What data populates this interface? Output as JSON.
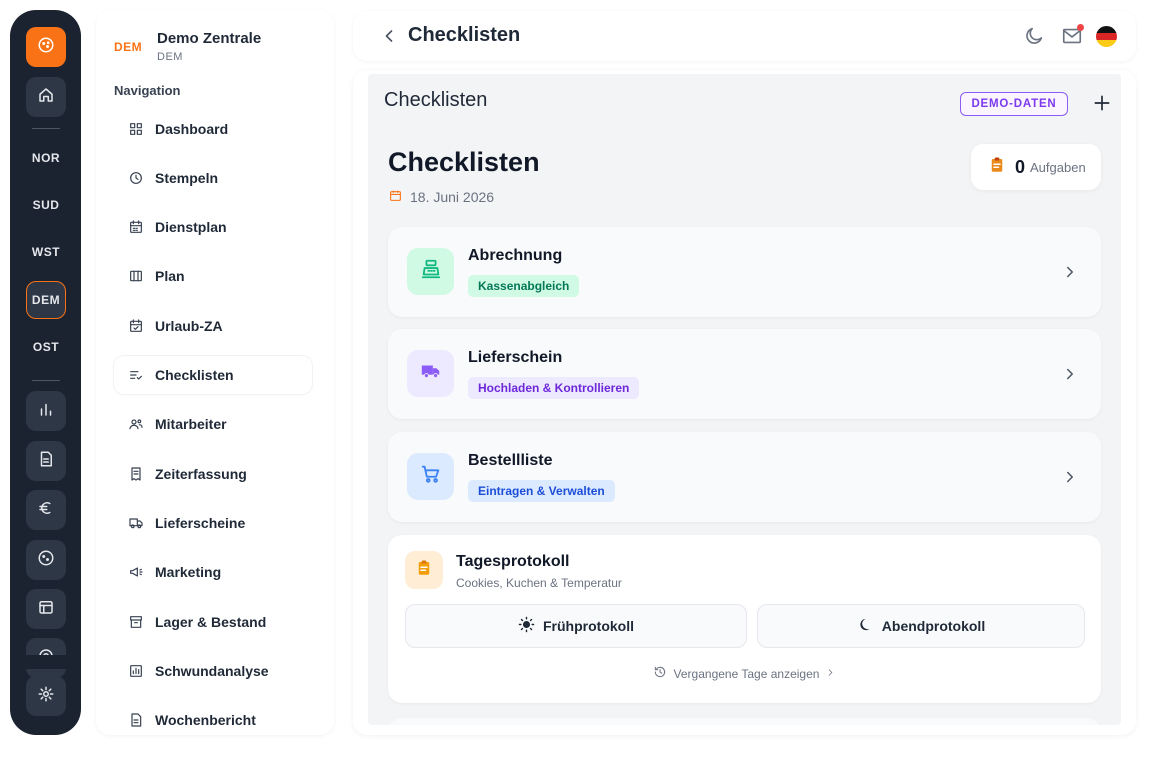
{
  "rail": {
    "codes": [
      "NOR",
      "SUD",
      "WST",
      "DEM",
      "OST"
    ],
    "active_code": "DEM"
  },
  "sidebar": {
    "org_code": "DEM",
    "org_name": "Demo Zentrale",
    "org_sub": "DEM",
    "nav_title": "Navigation",
    "items": [
      {
        "label": "Dashboard",
        "icon": "grid-icon"
      },
      {
        "label": "Stempeln",
        "icon": "clock-icon"
      },
      {
        "label": "Dienstplan",
        "icon": "calendar-grid-icon"
      },
      {
        "label": "Plan",
        "icon": "columns-icon"
      },
      {
        "label": "Urlaub-ZA",
        "icon": "calendar-check-icon"
      },
      {
        "label": "Checklisten",
        "icon": "list-check-icon",
        "active": true
      },
      {
        "label": "Mitarbeiter",
        "icon": "users-icon"
      },
      {
        "label": "Zeiterfassung",
        "icon": "receipt-icon"
      },
      {
        "label": "Lieferscheine",
        "icon": "truck-icon"
      },
      {
        "label": "Marketing",
        "icon": "megaphone-icon"
      },
      {
        "label": "Lager & Bestand",
        "icon": "archive-icon"
      },
      {
        "label": "Schwundanalyse",
        "icon": "bar-chart-icon"
      },
      {
        "label": "Wochenbericht",
        "icon": "document-icon"
      }
    ]
  },
  "topbar": {
    "title": "Checklisten"
  },
  "main": {
    "panel_title": "Checklisten",
    "demo_badge": "DEMO-DATEN",
    "heading": "Checklisten",
    "date": "18. Juni 2026",
    "tasks": {
      "count": "0",
      "label": "Aufgaben"
    },
    "cards": [
      {
        "title": "Abrechnung",
        "tag": "Kassenabgleich",
        "icon": "cash-register-icon",
        "icon_bg": "#d1fae5",
        "icon_color": "#10b981",
        "tag_bg": "#d1fae5",
        "tag_color": "#047857"
      },
      {
        "title": "Lieferschein",
        "tag": "Hochladen & Kontrollieren",
        "icon": "truck-icon",
        "icon_bg": "#ede9fe",
        "icon_color": "#8b5cf6",
        "tag_bg": "#ede9fe",
        "tag_color": "#6d28d9"
      },
      {
        "title": "Bestellliste",
        "tag": "Eintragen & Verwalten",
        "icon": "cart-icon",
        "icon_bg": "#dbeafe",
        "icon_color": "#3b82f6",
        "tag_bg": "#dbeafe",
        "tag_color": "#1d4ed8"
      }
    ],
    "protocol": {
      "title": "Tagesprotokoll",
      "subtitle": "Cookies, Kuchen & Temperatur",
      "morning_label": "Frühprotokoll",
      "evening_label": "Abendprotokoll",
      "history_label": "Vergangene Tage anzeigen"
    }
  },
  "colors": {
    "accent": "#f97316",
    "rail_bg": "#1b2331",
    "demo_purple": "#7c3aed"
  }
}
